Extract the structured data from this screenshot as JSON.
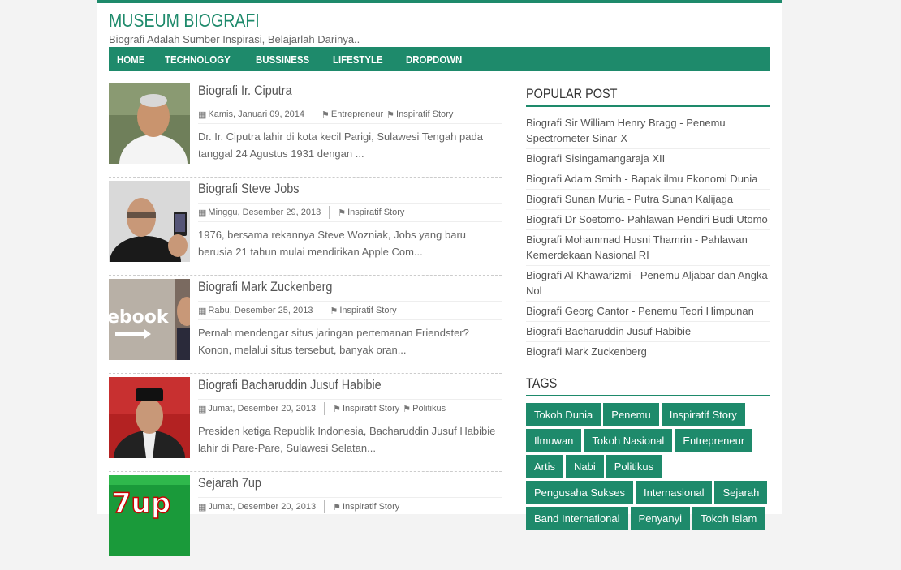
{
  "site": {
    "title": "MUSEUM BIOGRAFI",
    "description": "Biografi Adalah Sumber Inspirasi, Belajarlah Darinya.."
  },
  "nav": [
    "HOME",
    "TECHNOLOGY",
    "BUSSINESS",
    "LIFESTYLE",
    "DROPDOWN"
  ],
  "posts": [
    {
      "title": "Biografi Ir. Ciputra",
      "date": "Kamis, Januari 09, 2014",
      "tags": [
        "Entrepreneur",
        "Inspiratif Story"
      ],
      "excerpt": "Dr. Ir. Ciputra lahir di kota kecil Parigi, Sulawesi Tengah pada tanggal 24 Agustus 1931 dengan ..."
    },
    {
      "title": "Biografi Steve Jobs",
      "date": "Minggu, Desember 29, 2013",
      "tags": [
        "Inspiratif Story"
      ],
      "excerpt": "1976, bersama rekannya Steve Wozniak, Jobs yang baru berusia 21 tahun mulai mendirikan Apple Com..."
    },
    {
      "title": "Biografi Mark Zuckenberg",
      "date": "Rabu, Desember 25, 2013",
      "tags": [
        "Inspiratif Story"
      ],
      "excerpt": "Pernah mendengar situs jaringan pertemanan Friendster? Konon, melalui situs tersebut, banyak oran...",
      "thumb_text": "ebook"
    },
    {
      "title": "Biografi Bacharuddin Jusuf Habibie",
      "date": "Jumat, Desember 20, 2013",
      "tags": [
        "Inspiratif Story",
        "Politikus"
      ],
      "excerpt": "Presiden ketiga Republik Indonesia, Bacharuddin Jusuf Habibie lahir di Pare-Pare, Sulawesi Selatan..."
    },
    {
      "title": "Sejarah 7up",
      "date": "Jumat, Desember 20, 2013",
      "tags": [
        "Inspiratif Story"
      ],
      "excerpt": "",
      "thumb_text": "7up"
    }
  ],
  "sidebar": {
    "popular_title": "POPULAR POST",
    "popular": [
      "Biografi Sir William Henry Bragg - Penemu Spectrometer Sinar-X",
      "Biografi Sisingamangaraja XII",
      "Biografi Adam Smith - Bapak ilmu Ekonomi Dunia",
      "Biografi Sunan Muria - Putra Sunan Kalijaga",
      "Biografi Dr Soetomo- Pahlawan Pendiri Budi Utomo",
      "Biografi Mohammad Husni Thamrin - Pahlawan Kemerdekaan Nasional RI",
      "Biografi Al Khawarizmi - Penemu Aljabar dan Angka Nol",
      "Biografi Georg Cantor - Penemu Teori Himpunan",
      "Biografi Bacharuddin Jusuf Habibie",
      "Biografi Mark Zuckenberg"
    ],
    "tags_title": "TAGS",
    "tags": [
      "Tokoh Dunia",
      "Penemu",
      "Inspiratif Story",
      "Ilmuwan",
      "Tokoh Nasional",
      "Entrepreneur",
      "Artis",
      "Nabi",
      "Politikus",
      "Pengusaha Sukses",
      "Internasional",
      "Sejarah",
      "Band International",
      "Penyanyi",
      "Tokoh Islam"
    ]
  },
  "colors": {
    "accent": "#1e8a6b"
  }
}
